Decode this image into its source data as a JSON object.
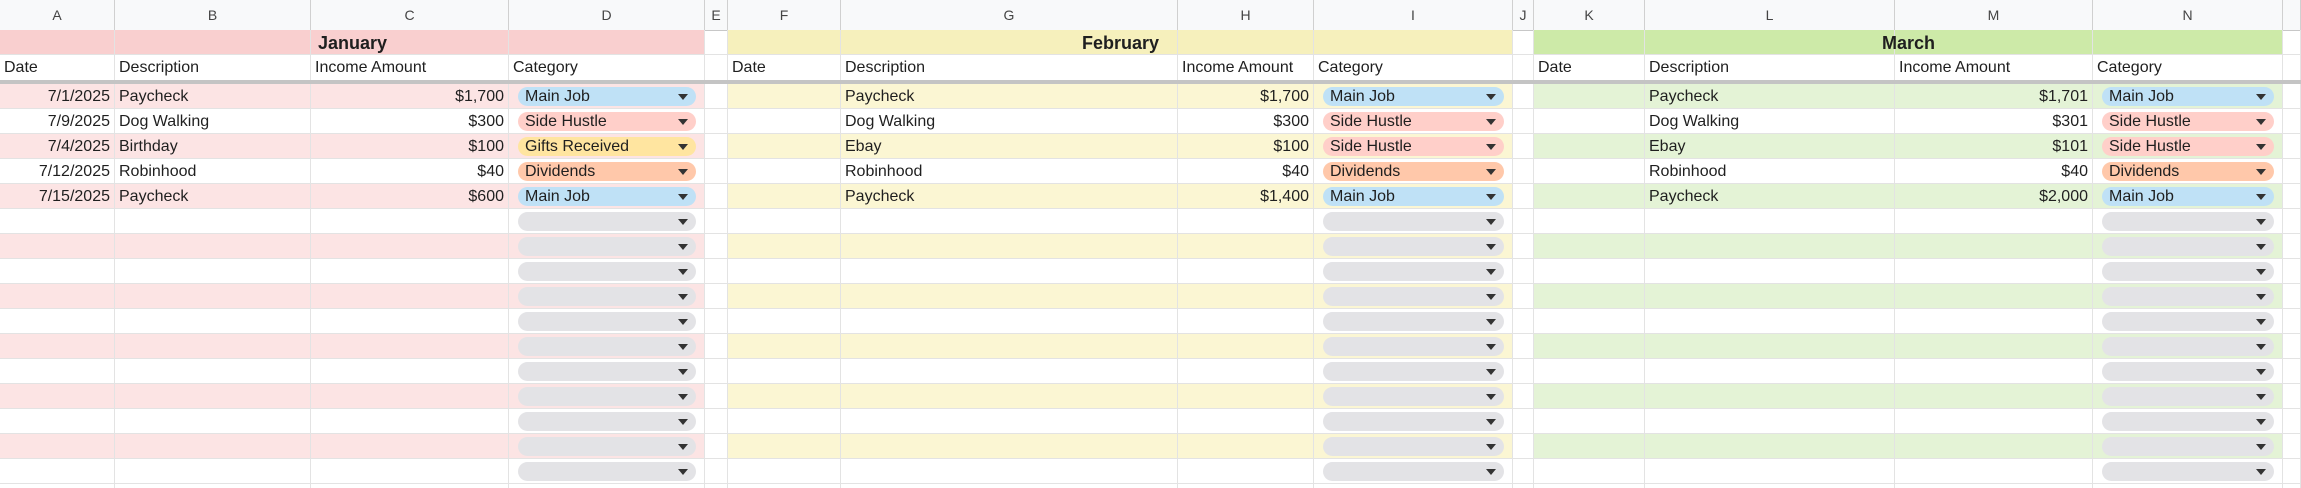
{
  "column_letters": [
    "A",
    "B",
    "C",
    "D",
    "E",
    "F",
    "G",
    "H",
    "I",
    "J",
    "K",
    "L",
    "M",
    "N",
    ""
  ],
  "colors": {
    "january_band": "#fce4e4",
    "february_band": "#fbf6d3",
    "march_band": "#e4f3d6",
    "january_header": "#f9cfcf",
    "february_header": "#f6f0bc",
    "march_header": "#cdeaa8",
    "chip_empty": "#e3e3e6"
  },
  "category_chip_colors": {
    "Main Job": "#bfe1f6",
    "Side Hustle": "#ffcfc9",
    "Gifts Received": "#ffe5a0",
    "Dividends": "#ffc8aa"
  },
  "months": [
    {
      "title": "January",
      "headers": [
        "Date",
        "Description",
        "Income Amount",
        "Category"
      ],
      "rows": [
        {
          "date": "7/1/2025",
          "description": "Paycheck",
          "amount": "$1,700",
          "category": "Main Job"
        },
        {
          "date": "7/9/2025",
          "description": "Dog Walking",
          "amount": "$300",
          "category": "Side Hustle"
        },
        {
          "date": "7/4/2025",
          "description": "Birthday",
          "amount": "$100",
          "category": "Gifts Received"
        },
        {
          "date": "7/12/2025",
          "description": "Robinhood",
          "amount": "$40",
          "category": "Dividends"
        },
        {
          "date": "7/15/2025",
          "description": "Paycheck",
          "amount": "$600",
          "category": "Main Job"
        }
      ]
    },
    {
      "title": "February",
      "headers": [
        "Date",
        "Description",
        "Income Amount",
        "Category"
      ],
      "rows": [
        {
          "date": "",
          "description": "Paycheck",
          "amount": "$1,700",
          "category": "Main Job"
        },
        {
          "date": "",
          "description": "Dog Walking",
          "amount": "$300",
          "category": "Side Hustle"
        },
        {
          "date": "",
          "description": "Ebay",
          "amount": "$100",
          "category": "Side Hustle"
        },
        {
          "date": "",
          "description": "Robinhood",
          "amount": "$40",
          "category": "Dividends"
        },
        {
          "date": "",
          "description": "Paycheck",
          "amount": "$1,400",
          "category": "Main Job"
        }
      ]
    },
    {
      "title": "March",
      "headers": [
        "Date",
        "Description",
        "Income Amount",
        "Category"
      ],
      "rows": [
        {
          "date": "",
          "description": "Paycheck",
          "amount": "$1,701",
          "category": "Main Job"
        },
        {
          "date": "",
          "description": "Dog Walking",
          "amount": "$301",
          "category": "Side Hustle"
        },
        {
          "date": "",
          "description": "Ebay",
          "amount": "$101",
          "category": "Side Hustle"
        },
        {
          "date": "",
          "description": "Robinhood",
          "amount": "$40",
          "category": "Dividends"
        },
        {
          "date": "",
          "description": "Paycheck",
          "amount": "$2,000",
          "category": "Main Job"
        }
      ]
    }
  ],
  "empty_rows": 11
}
